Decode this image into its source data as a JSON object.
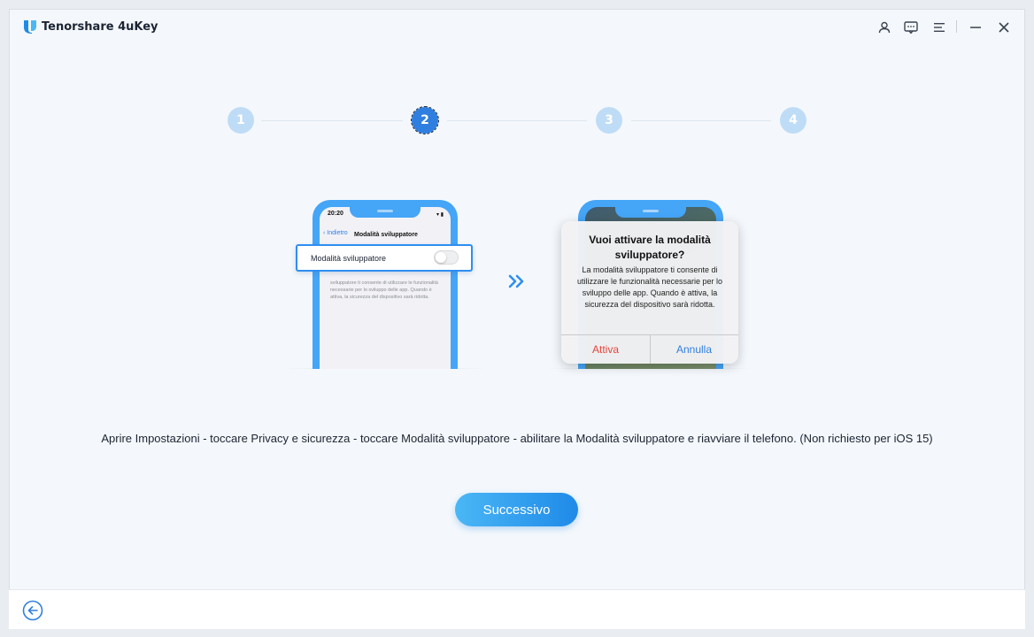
{
  "app": {
    "title": "Tenorshare 4uKey",
    "brand_color": "#1f8ae8"
  },
  "titlebar_icons": [
    "user-icon",
    "feedback-icon",
    "menu-icon",
    "minimize-icon",
    "close-icon"
  ],
  "steps": [
    {
      "label": "1",
      "active": false
    },
    {
      "label": "2",
      "active": true
    },
    {
      "label": "3",
      "active": false
    },
    {
      "label": "4",
      "active": false
    }
  ],
  "phone_left": {
    "time": "20:20",
    "back_label": "Indietro",
    "nav_title": "Modalità sviluppatore",
    "setting_label": "Modalità sviluppatore",
    "description": "sviluppatore ti consente di utilizzare le funzionalità necessarie per lo sviluppo delle app. Quando è attiva, la sicurezza del dispositivo sarà ridotta."
  },
  "dialog": {
    "title": "Vuoi attivare la modalità sviluppatore?",
    "message": "La modalità sviluppatore ti consente di utilizzare le funzionalità necessarie per lo sviluppo delle app. Quando è attiva, la sicurezza del dispositivo sarà ridotta.",
    "confirm_label": "Attiva",
    "cancel_label": "Annulla",
    "confirm_color": "#e8453c",
    "cancel_color": "#2f7fe0"
  },
  "instruction": "Aprire Impostazioni - toccare Privacy e sicurezza - toccare Modalità sviluppatore - abilitare la Modalità sviluppatore e riavviare il telefono. (Non richiesto per iOS 15)",
  "next_button": "Successivo"
}
